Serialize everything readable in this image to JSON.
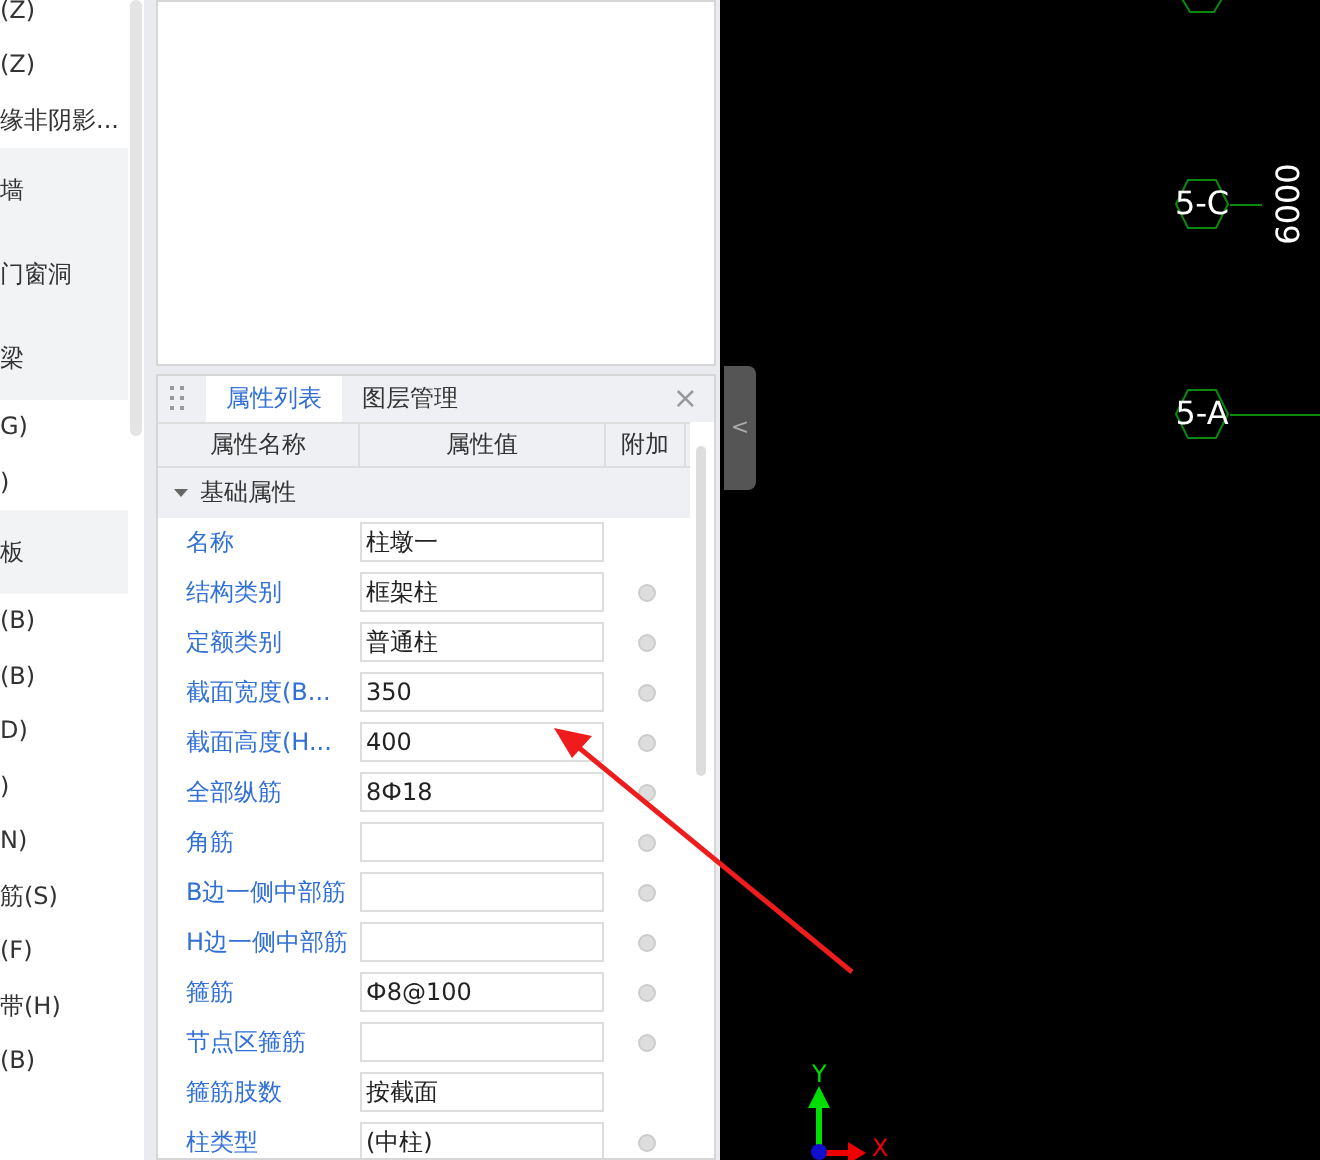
{
  "sidebar": {
    "items": [
      {
        "label": "(Z)",
        "highlighted": false
      },
      {
        "label": "(Z)",
        "highlighted": false
      },
      {
        "label": "缘非阴影...",
        "highlighted": false
      },
      {
        "label": "墙",
        "highlighted": true
      },
      {
        "label": "门窗洞",
        "highlighted": true
      },
      {
        "label": "梁",
        "highlighted": true
      },
      {
        "label": "G)",
        "highlighted": false
      },
      {
        "label": ")",
        "highlighted": false
      },
      {
        "label": "板",
        "highlighted": true
      },
      {
        "label": "(B)",
        "highlighted": false
      },
      {
        "label": "(B)",
        "highlighted": false
      },
      {
        "label": "D)",
        "highlighted": false
      },
      {
        "label": ")",
        "highlighted": false
      },
      {
        "label": "N)",
        "highlighted": false
      },
      {
        "label": "筋(S)",
        "highlighted": false
      },
      {
        "label": "(F)",
        "highlighted": false
      },
      {
        "label": "带(H)",
        "highlighted": false
      },
      {
        "label": "(B)",
        "highlighted": false
      }
    ]
  },
  "properties": {
    "tabs": [
      {
        "label": "属性列表",
        "selected": true
      },
      {
        "label": "图层管理",
        "selected": false
      }
    ],
    "close": "×",
    "columns": [
      "属性名称",
      "属性值",
      "附加"
    ],
    "group": {
      "label": "基础属性",
      "expanded": true
    },
    "rows": [
      {
        "name": "名称",
        "value": "柱墩一",
        "has_option": false
      },
      {
        "name": "结构类别",
        "value": "框架柱",
        "has_option": true
      },
      {
        "name": "定额类别",
        "value": "普通柱",
        "has_option": true
      },
      {
        "name": "截面宽度(B...",
        "value": "350",
        "has_option": true
      },
      {
        "name": "截面高度(H...",
        "value": "400",
        "has_option": true
      },
      {
        "name": "全部纵筋",
        "value": "8Ф18",
        "has_option": true
      },
      {
        "name": "角筋",
        "value": "",
        "has_option": true
      },
      {
        "name": "B边一侧中部筋",
        "value": "",
        "has_option": true
      },
      {
        "name": "H边一侧中部筋",
        "value": "",
        "has_option": true
      },
      {
        "name": "箍筋",
        "value": "Ф8@100",
        "has_option": true
      },
      {
        "name": "节点区箍筋",
        "value": "",
        "has_option": true
      },
      {
        "name": "箍筋肢数",
        "value": "按截面",
        "has_option": false
      },
      {
        "name": "柱类型",
        "value": "(中柱)",
        "has_option": true
      }
    ]
  },
  "canvas": {
    "collapse": "<",
    "axes": [
      {
        "label": "5-C"
      },
      {
        "label": "5-A"
      }
    ],
    "dimension": "6000",
    "gizmo": {
      "x": "X",
      "y": "Y"
    }
  }
}
